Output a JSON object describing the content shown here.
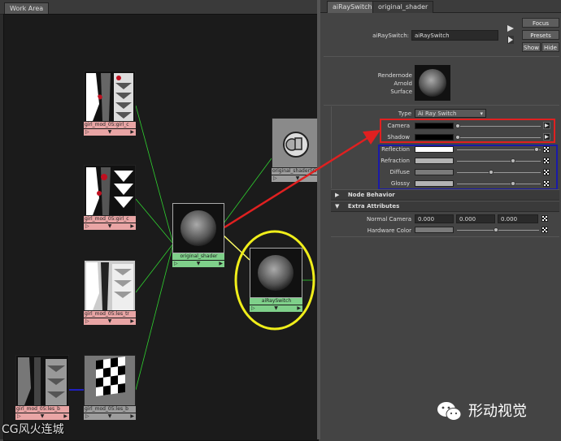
{
  "work_area": {
    "tab_label": "Work Area",
    "nodes": {
      "n1": {
        "label": "girl_mod_05:girl_c",
        "ports": [
          "▷",
          "▼",
          "▶"
        ]
      },
      "n2": {
        "label": "girl_mod_05:girl_c",
        "ports": [
          "▷",
          "▼",
          "▶"
        ]
      },
      "n3": {
        "label": "girl_mod_05:les_tr",
        "ports": [
          "▷",
          "▼",
          "▶"
        ]
      },
      "n4": {
        "label": "girl_mod_05:les_b",
        "ports": [
          "▷",
          "▼",
          "▶"
        ]
      },
      "n5": {
        "label": "girl_mod_05:les_b",
        "ports": [
          "▷",
          "▼",
          "▶"
        ]
      },
      "orig": {
        "label": "original_shader",
        "ports": [
          "▷",
          "▼",
          "▶"
        ]
      },
      "airay": {
        "label": "aiRaySwitch",
        "ports": [
          "▷",
          "▼",
          "▶"
        ]
      },
      "origSG": {
        "label": "original_shaderSG",
        "ports": [
          "▷",
          "▼",
          "▶"
        ]
      }
    }
  },
  "attribute_editor": {
    "tabs": [
      "aiRaySwitch",
      "original_shader"
    ],
    "node_name_label": "aiRaySwitch:",
    "node_name_value": "aiRaySwitch",
    "buttons": {
      "focus": "Focus",
      "presets": "Presets",
      "show": "Show",
      "hide": "Hide"
    },
    "swatch_caption": [
      "Rendernode",
      "Arnold",
      "Surface"
    ],
    "type_label": "Type",
    "type_value": "Ai Ray Switch",
    "rows": [
      {
        "label": "Camera",
        "color": "#000000",
        "knob": 0.0
      },
      {
        "label": "Shadow",
        "color": "#000000",
        "knob": 0.0
      },
      {
        "label": "Reflection",
        "color": "#ffffff",
        "knob": 1.0
      },
      {
        "label": "Refraction",
        "color": "#b3b3b3",
        "knob": 0.7
      },
      {
        "label": "Diffuse",
        "color": "#7a7a7a",
        "knob": 0.42
      },
      {
        "label": "Glossy",
        "color": "#b3b3b3",
        "knob": 0.7
      }
    ],
    "sections": {
      "node_behavior": "Node Behavior",
      "extra_attributes": "Extra Attributes"
    },
    "normal_camera_label": "Normal Camera",
    "normal_camera_values": [
      "0.000",
      "0.000",
      "0.000"
    ],
    "hardware_color_label": "Hardware Color",
    "hardware_color": "#7a7a7a"
  },
  "annotations": {
    "red_box_color": "#e02020",
    "blue_box_color": "#1a1aa8",
    "yellow_circle_color": "#f0ee1a"
  },
  "watermarks": {
    "left": "CG风火连城",
    "right": "形动视觉"
  }
}
